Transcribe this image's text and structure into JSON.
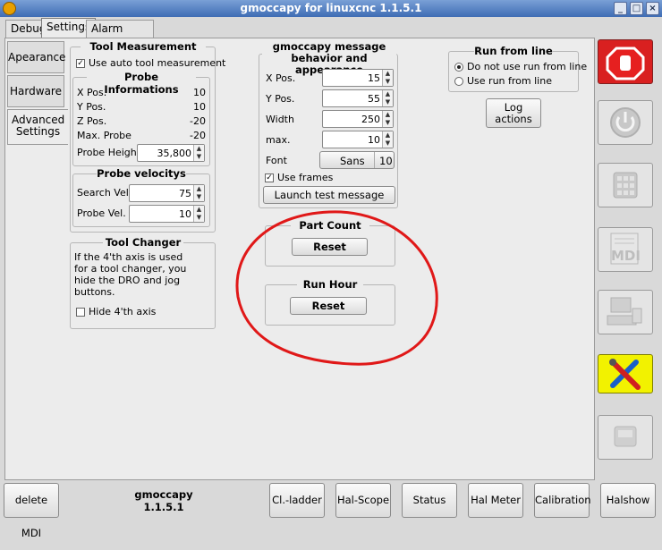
{
  "window": {
    "title": "gmoccapy for linuxcnc   1.1.5.1"
  },
  "tabs": [
    "Debug",
    "Settings",
    "Alarm History"
  ],
  "vtabs": [
    "Apearance",
    "Hardware",
    "Advanced Settings"
  ],
  "tool_measurement": {
    "title": "Tool Measurement",
    "auto_label": "Use auto tool measurement",
    "probe_info_title": "Probe Informations",
    "rows": [
      {
        "label": "X Pos.",
        "value": "10"
      },
      {
        "label": "Y Pos.",
        "value": "10"
      },
      {
        "label": "Z Pos.",
        "value": "-20"
      },
      {
        "label": "Max. Probe",
        "value": "-20"
      }
    ],
    "probe_height_label": "Probe Height",
    "probe_height_value": "35,800",
    "velocity_title": "Probe velocitys",
    "search_label": "Search Vel.",
    "search_value": "75",
    "probe_vel_label": "Probe Vel.",
    "probe_vel_value": "10"
  },
  "tool_changer": {
    "title": "Tool Changer",
    "text": "If the 4'th axis is used for a tool changer, you hide the DRO and jog buttons.",
    "hide_label": "Hide 4'th axis"
  },
  "message": {
    "title": "gmoccapy message behavior and appearance",
    "xpos_label": "X Pos.",
    "xpos_value": "15",
    "ypos_label": "Y Pos.",
    "ypos_value": "55",
    "width_label": "Width",
    "width_value": "250",
    "max_label": "max.",
    "max_value": "10",
    "font_label": "Font",
    "font_name": "Sans",
    "font_size": "10",
    "frames_label": "Use frames",
    "launch_label": "Launch test message"
  },
  "part_count": {
    "title": "Part Count",
    "reset": "Reset"
  },
  "run_hour": {
    "title": "Run Hour",
    "reset": "Reset"
  },
  "run_from_line": {
    "title": "Run from line",
    "option1": "Do not use run from line",
    "option2": "Use run from line"
  },
  "log_actions": "Log actions",
  "bottom": {
    "delete_mdi": "delete MDI",
    "app_name": "gmoccapy",
    "version": "1.1.5.1",
    "buttons": [
      "Cl.-ladder",
      "Hal-Scope",
      "Status",
      "Hal Meter",
      "Calibration",
      "Halshow"
    ]
  },
  "side_mdi_label": "MDI",
  "colors": {
    "estop": "#e62020",
    "settings_active": "#f2f200",
    "annotation": "#e01818"
  }
}
